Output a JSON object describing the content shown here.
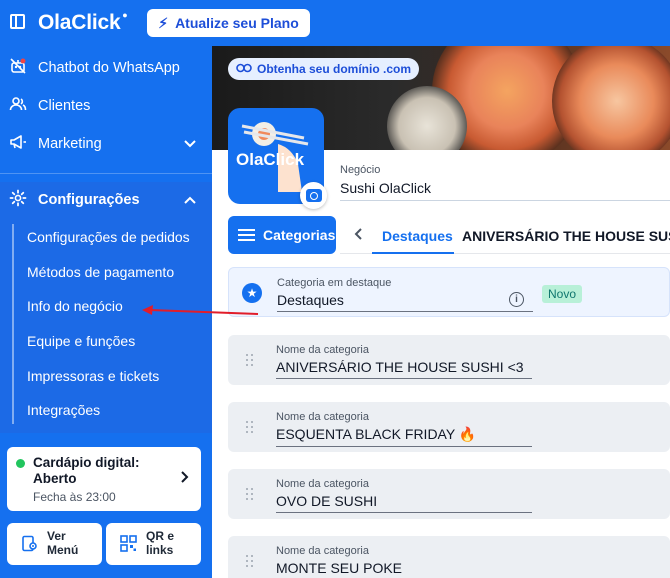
{
  "topbar": {
    "logo": "OlaClick",
    "upgrade_label": "Atualize seu Plano"
  },
  "sidebar": {
    "items": [
      {
        "label": "Chatbot do WhatsApp",
        "icon": "robot-icon"
      },
      {
        "label": "Clientes",
        "icon": "users-icon"
      },
      {
        "label": "Marketing",
        "icon": "megaphone-icon"
      }
    ],
    "config": {
      "label": "Configurações",
      "icon": "gear-icon",
      "subitems": [
        "Configurações de pedidos",
        "Métodos de pagamento",
        "Info do negócio",
        "Equipe e funções",
        "Impressoras e tickets",
        "Integrações"
      ]
    },
    "menu_card": {
      "title": "Cardápio digital: Aberto",
      "subtitle": "Fecha às 23:00",
      "status_color": "#22c55e"
    },
    "buttons": [
      {
        "label": "Ver Menú",
        "icon": "eye-menu-icon"
      },
      {
        "label": "QR e links",
        "icon": "qr-code-icon"
      }
    ]
  },
  "main": {
    "domain_pill": "Obtenha seu domínio .com",
    "avatar_text": "OlaClick",
    "business": {
      "label": "Negócio",
      "value": "Sushi OlaClick"
    },
    "categories_button": "Categorias",
    "tabs": [
      "Destaques",
      "ANIVERSÁRIO THE HOUSE SUSHI"
    ],
    "featured": {
      "label": "Categoria em destaque",
      "value": "Destaques",
      "badge": "Novo"
    },
    "categories": [
      {
        "label": "Nome da categoria",
        "value": "ANIVERSÁRIO THE HOUSE SUSHI <3"
      },
      {
        "label": "Nome da categoria",
        "value": "ESQUENTA BLACK FRIDAY 🔥"
      },
      {
        "label": "Nome da categoria",
        "value": "OVO DE SUSHI"
      },
      {
        "label": "Nome da categoria",
        "value": "MONTE SEU POKE"
      }
    ]
  },
  "colors": {
    "brand": "#1570ef",
    "annotation_arrow": "#e11d2a"
  }
}
